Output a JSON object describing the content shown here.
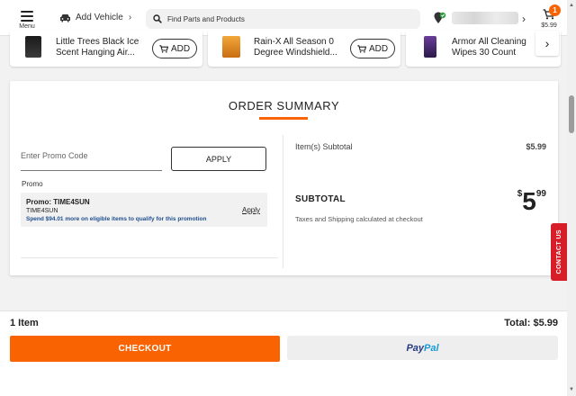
{
  "header": {
    "menu_label": "Menu",
    "add_vehicle_label": "Add Vehicle",
    "search_placeholder": "Find Parts and Products",
    "cart_count": "1",
    "cart_amount": "$5.99"
  },
  "carousel": {
    "items": [
      {
        "name": "Little Trees Black Ice Scent Hanging Air...",
        "button": "ADD"
      },
      {
        "name": "Rain-X All Season 0 Degree Windshield...",
        "button": "ADD"
      },
      {
        "name": "Armor All Cleaning Wipes 30 Count"
      }
    ]
  },
  "summary": {
    "title": "ORDER SUMMARY",
    "promo_placeholder": "Enter Promo Code",
    "apply_button": "APPLY",
    "promo_label": "Promo",
    "promo_code_line": "Promo: TIME4SUN",
    "promo_code_sub": "TIME4SUN",
    "promo_message": "Spend $94.01 more on eligible items to qualify for this promotion",
    "promo_apply_link": "Apply",
    "items_subtotal_label": "Item(s) Subtotal",
    "items_subtotal_value": "$5.99",
    "subtotal_label": "SUBTOTAL",
    "subtotal_currency": "$",
    "subtotal_dollars": "5",
    "subtotal_cents": "99",
    "tax_note": "Taxes and Shipping calculated at checkout"
  },
  "contact_tab": "CONTACT US",
  "footer": {
    "item_count": "1 Item",
    "total": "Total: $5.99",
    "checkout_button": "CHECKOUT",
    "paypal_part1": "Pay",
    "paypal_part2": "Pal"
  },
  "colors": {
    "brand_orange": "#f96302",
    "link_blue": "#1f4e8f",
    "contact_red": "#d71e28",
    "paypal_dark": "#253b80",
    "paypal_light": "#179bd7"
  }
}
